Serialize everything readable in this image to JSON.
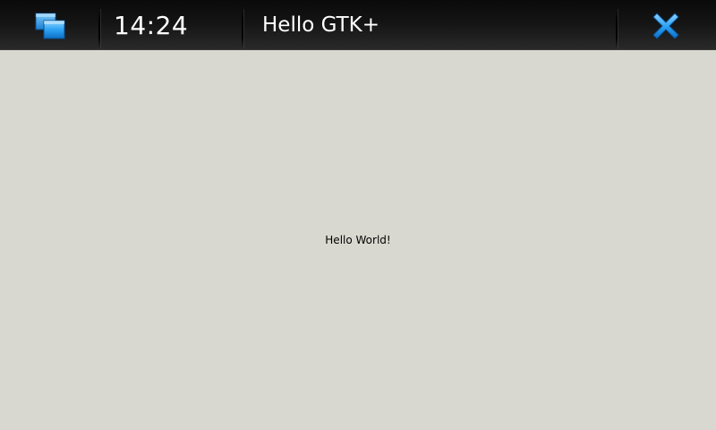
{
  "titlebar": {
    "switcher_icon": "task-switcher-icon",
    "clock": "14:24",
    "title": "Hello GTK+",
    "close_icon": "close-icon"
  },
  "content": {
    "label": "Hello World!"
  },
  "colors": {
    "background": "#d9d8d0",
    "titlebar": "#141414",
    "accent": "#1e9bef",
    "text_light": "#ffffff"
  }
}
